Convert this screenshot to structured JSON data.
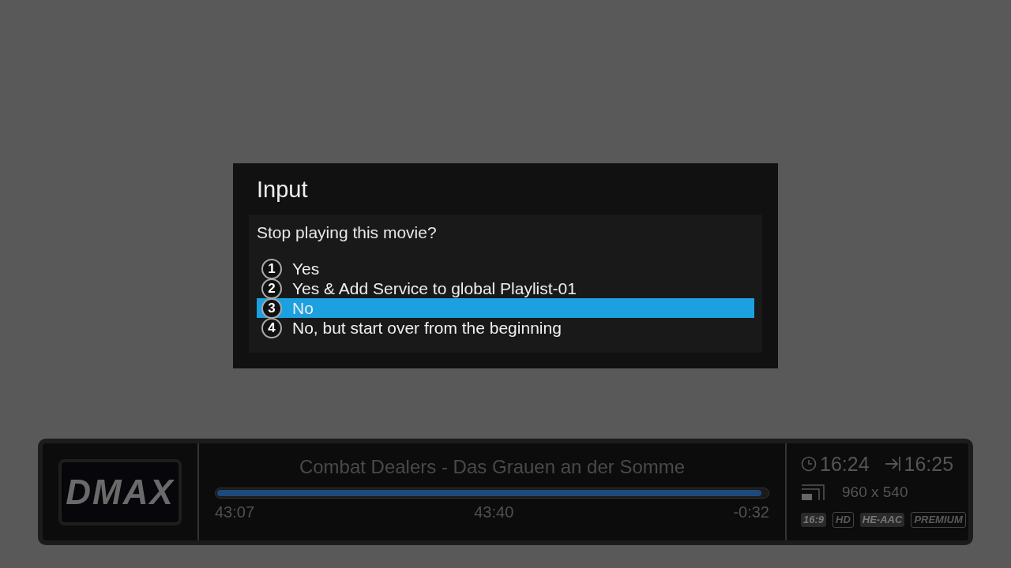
{
  "dialog": {
    "title": "Input",
    "question": "Stop playing this movie?",
    "options": [
      {
        "number": "1",
        "label": "Yes",
        "selected": false
      },
      {
        "number": "2",
        "label": "Yes & Add Service to global Playlist-01",
        "selected": false
      },
      {
        "number": "3",
        "label": "No",
        "selected": true
      },
      {
        "number": "4",
        "label": "No, but start over from the beginning",
        "selected": false
      }
    ]
  },
  "infobar": {
    "channel_logo": "DMAX",
    "title": "Combat Dealers - Das Grauen an der Somme",
    "progress": {
      "level": 0.99
    },
    "start_time": "43:07",
    "current_time": "43:40",
    "remaining": "-0:32",
    "clock": "16:24",
    "end_time": "16:25",
    "resolution": "960 x 540",
    "badges": [
      {
        "label": "16:9",
        "active": true
      },
      {
        "label": "HD",
        "active": false
      },
      {
        "label": "HE-AAC",
        "active": true
      },
      {
        "label": "PREMIUM",
        "active": false
      }
    ]
  }
}
